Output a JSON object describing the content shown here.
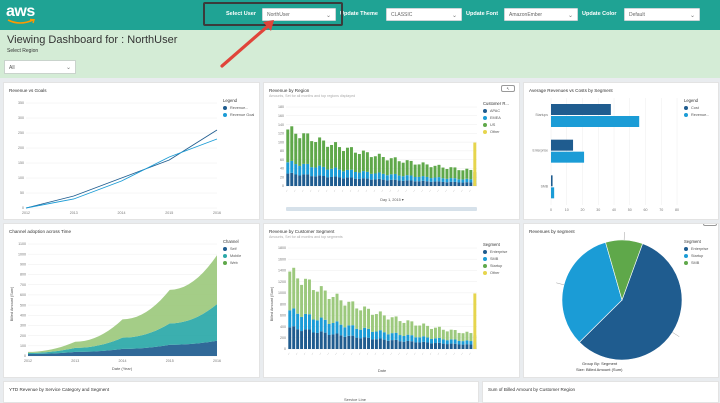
{
  "header": {
    "logo_text": "aws",
    "controls": [
      {
        "label": "Select User",
        "value": "NorthUser"
      },
      {
        "label": "Update Theme",
        "value": "CLASSIC"
      },
      {
        "label": "Update Font",
        "value": "AmazonEmber"
      },
      {
        "label": "Update Color",
        "value": "Default"
      }
    ]
  },
  "page": {
    "title": "Viewing Dashboard for : NorthUser",
    "region_label": "Select Region",
    "region_value": "All"
  },
  "colors": {
    "topbar": "#1fa394",
    "header_band": "#d4ecd6",
    "navy": "#1f5c8f",
    "sky": "#1b9cd6",
    "green": "#5fa84a",
    "light_green": "#9cc97d",
    "teal": "#2aa8a8",
    "yellow": "#e6d54d",
    "arrow": "#e0443a"
  },
  "panels": {
    "revenue_by_years": {
      "title": "Revenue vs Goals",
      "legend_title": "Legend",
      "legend_items": [
        "Revenue...",
        "Revenue Goal"
      ]
    },
    "revenue_by_region": {
      "title": "Revenue by Region",
      "subtitle": "Amounts, Set for all months and top regions displayed",
      "legend_title": "Customer R...",
      "legend_items": [
        "APAC",
        "EMEA",
        "US",
        "Other"
      ],
      "xlabel": "Day 1, 2015 ▾",
      "focus_label": "↖"
    },
    "avg_revenue_by_segment": {
      "title": "Average Revenues vs Costs by Segment",
      "legend_title": "Legend",
      "legend_items": [
        "Cost",
        "Revenue..."
      ]
    },
    "channel_adoption": {
      "title": "Channel adoption across Time",
      "legend_title": "Channel",
      "legend_items": [
        "Self",
        "Mobile",
        "Web"
      ],
      "xlabel": "Date (Year)",
      "ylabel": "Billed Amount (Sum)"
    },
    "revenue_by_customer_segment": {
      "title": "Revenue by Customer Segment",
      "subtitle": "Amounts, Set for all months and top segments",
      "legend_title": "Segment",
      "legend_items": [
        "Enterprise",
        "SMB",
        "Startup",
        "Other"
      ],
      "xlabel": "Date",
      "ylabel": "Billed Amount (Sum)"
    },
    "revenue_by_segment_pie": {
      "title": "Revenues by segment",
      "legend_title": "Segment",
      "legend_items": [
        "Enterprise",
        "Startup",
        "SMB"
      ],
      "caption_line1": "Group By: Segment",
      "caption_line2": "Size: Billed Amount (Sum)",
      "focus_label": "↖"
    },
    "bottom_left": {
      "title": "YTD Revenue by Service Category and Segment",
      "sub": "Service Line"
    },
    "bottom_right": {
      "title": "Sum of Billed Amount by Customer Region"
    }
  },
  "chart_data": [
    {
      "type": "line",
      "title": "Revenue vs Goals",
      "x": [
        "2012",
        "2013",
        "2014",
        "2015",
        "2016"
      ],
      "ylim": [
        0,
        350
      ],
      "yticks": [
        "350",
        "300",
        "250",
        "200",
        "150",
        "100",
        "50",
        "0"
      ],
      "series": [
        {
          "name": "Revenue...",
          "values": [
            0,
            40,
            100,
            160,
            260
          ]
        },
        {
          "name": "Revenue Goal",
          "values": [
            0,
            30,
            90,
            170,
            230
          ]
        }
      ]
    },
    {
      "type": "bar",
      "title": "Revenues by Region",
      "stacked": true,
      "bars": 48,
      "ylim": [
        0,
        180
      ],
      "yticks": [
        "180",
        "160",
        "140",
        "120",
        "100",
        "80",
        "60",
        "40",
        "20",
        "0"
      ],
      "series": [
        {
          "name": "APAC",
          "share": 0.22
        },
        {
          "name": "EMEA",
          "share": 0.2
        },
        {
          "name": "US",
          "share": 0.58
        },
        {
          "name": "Other",
          "share": 0.0
        }
      ],
      "start": 140,
      "decay": 0.028
    },
    {
      "type": "bar",
      "orientation": "horizontal",
      "title": "Average Revenues vs Costs by Segment",
      "categories": [
        "Startups",
        "Enterprise",
        "SMB"
      ],
      "xlim": [
        0,
        80
      ],
      "xticks": [
        "0",
        "10",
        "20",
        "30",
        "40",
        "50",
        "60",
        "70",
        "80"
      ],
      "series": [
        {
          "name": "Cost",
          "values": [
            38,
            14,
            1
          ]
        },
        {
          "name": "Revenue...",
          "values": [
            56,
            21,
            2
          ]
        }
      ]
    },
    {
      "type": "area",
      "stacked": true,
      "title": "Channel adoption across Time",
      "x": [
        "2012",
        "2013",
        "2014",
        "2015",
        "2016"
      ],
      "ylim": [
        0,
        1100
      ],
      "yticks": [
        "1100",
        "1000",
        "900",
        "800",
        "700",
        "600",
        "500",
        "400",
        "300",
        "200",
        "100",
        "0"
      ],
      "series": [
        {
          "name": "Self",
          "values": [
            20,
            40,
            70,
            110,
            150
          ]
        },
        {
          "name": "Mobile",
          "values": [
            10,
            40,
            110,
            210,
            360
          ]
        },
        {
          "name": "Web",
          "values": [
            10,
            60,
            180,
            330,
            480
          ]
        }
      ]
    },
    {
      "type": "bar",
      "stacked": true,
      "title": "Revenue by Customer Segment",
      "bars": 48,
      "ylim": [
        0,
        1800
      ],
      "yticks": [
        "1800",
        "1600",
        "1400",
        "1200",
        "1000",
        "800",
        "600",
        "400",
        "200",
        "0"
      ],
      "start": 1500,
      "decay": 0.035
    },
    {
      "type": "pie",
      "title": "Revenues by segment",
      "categories": [
        "Enterprise",
        "Startup",
        "SMB"
      ],
      "values": [
        57,
        33,
        10
      ]
    }
  ]
}
